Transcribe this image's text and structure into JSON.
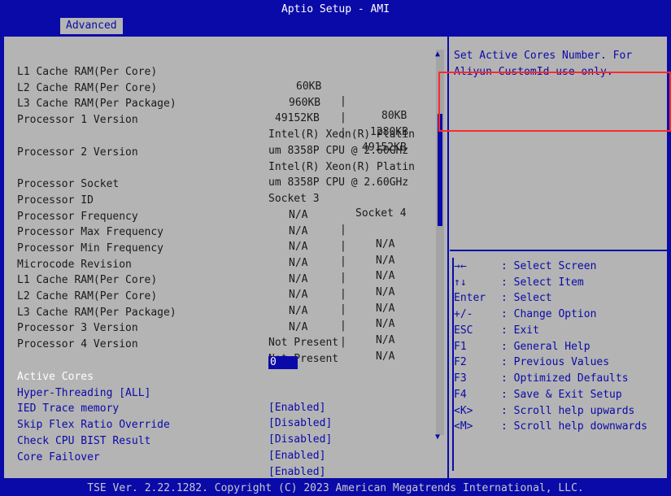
{
  "window": {
    "title": "Aptio Setup - AMI"
  },
  "tabs": [
    {
      "label": "Advanced"
    }
  ],
  "info_rows": [
    {
      "label": "L1 Cache RAM(Per Core)",
      "v1": "60KB",
      "v2": "80KB"
    },
    {
      "label": "L2 Cache RAM(Per Core)",
      "v1": "960KB",
      "v2": "1280KB"
    },
    {
      "label": "L3 Cache RAM(Per Package)",
      "v1": "49152KB",
      "v2": "49152KB"
    },
    {
      "label": "Processor 1 Version",
      "v1": "Intel(R) Xeon(R) Platin",
      "v2": ""
    },
    {
      "label": "",
      "v1": "um 8358P CPU @ 2.60GHz",
      "v2": ""
    },
    {
      "label": "Processor 2 Version",
      "v1": "Intel(R) Xeon(R) Platin",
      "v2": ""
    },
    {
      "label": "",
      "v1": "um 8358P CPU @ 2.60GHz",
      "v2": ""
    },
    {
      "label": "Processor Socket",
      "v1": "Socket 3",
      "v2": "Socket 4"
    },
    {
      "label": "Processor ID",
      "v1": "N/A",
      "v2": "N/A"
    },
    {
      "label": "Processor Frequency",
      "v1": "N/A",
      "v2": "N/A"
    },
    {
      "label": "Processor Max Frequency",
      "v1": "N/A",
      "v2": "N/A"
    },
    {
      "label": "Processor Min Frequency",
      "v1": "N/A",
      "v2": "N/A"
    },
    {
      "label": "Microcode Revision",
      "v1": "N/A",
      "v2": "N/A"
    },
    {
      "label": "L1 Cache RAM(Per Core)",
      "v1": "N/A",
      "v2": "N/A"
    },
    {
      "label": "L2 Cache RAM(Per Core)",
      "v1": "N/A",
      "v2": "N/A"
    },
    {
      "label": "L3 Cache RAM(Per Package)",
      "v1": "N/A",
      "v2": "N/A"
    },
    {
      "label": "Processor 3 Version",
      "v1": "Not Present",
      "v2": ""
    },
    {
      "label": "Processor 4 Version",
      "v1": "Not Present",
      "v2": ""
    }
  ],
  "settings": [
    {
      "label": "Active Cores",
      "value": "0"
    },
    {
      "label": "Hyper-Threading [ALL]",
      "value": "[Enabled]"
    },
    {
      "label": "IED Trace memory",
      "value": "[Disabled]"
    },
    {
      "label": "Skip Flex Ratio Override",
      "value": "[Disabled]"
    },
    {
      "label": "Check CPU BIST Result",
      "value": "[Enabled]"
    },
    {
      "label": "Core Failover",
      "value": "[Enabled]"
    }
  ],
  "help": {
    "text": "Set Active Cores Number. For Aliyun CustomId use only."
  },
  "keys": [
    {
      "key": "→←",
      "desc": ": Select Screen"
    },
    {
      "key": "↑↓",
      "desc": ": Select Item"
    },
    {
      "key": "Enter",
      "desc": ": Select"
    },
    {
      "key": "+/-",
      "desc": ": Change Option"
    },
    {
      "key": "ESC",
      "desc": ": Exit"
    },
    {
      "key": "F1",
      "desc": ": General Help"
    },
    {
      "key": "F2",
      "desc": ": Previous Values"
    },
    {
      "key": "F3",
      "desc": ": Optimized Defaults"
    },
    {
      "key": "F4",
      "desc": ": Save & Exit Setup"
    },
    {
      "key": "<K>",
      "desc": ": Scroll help upwards"
    },
    {
      "key": "<M>",
      "desc": ": Scroll help downwards"
    }
  ],
  "footer": {
    "text": "TSE Ver. 2.22.1282. Copyright (C) 2023 American Megatrends International, LLC."
  },
  "colors": {
    "background": "#0a0aa8",
    "panel": "#b4b4b4",
    "highlight_box": "#ff2a2a"
  }
}
